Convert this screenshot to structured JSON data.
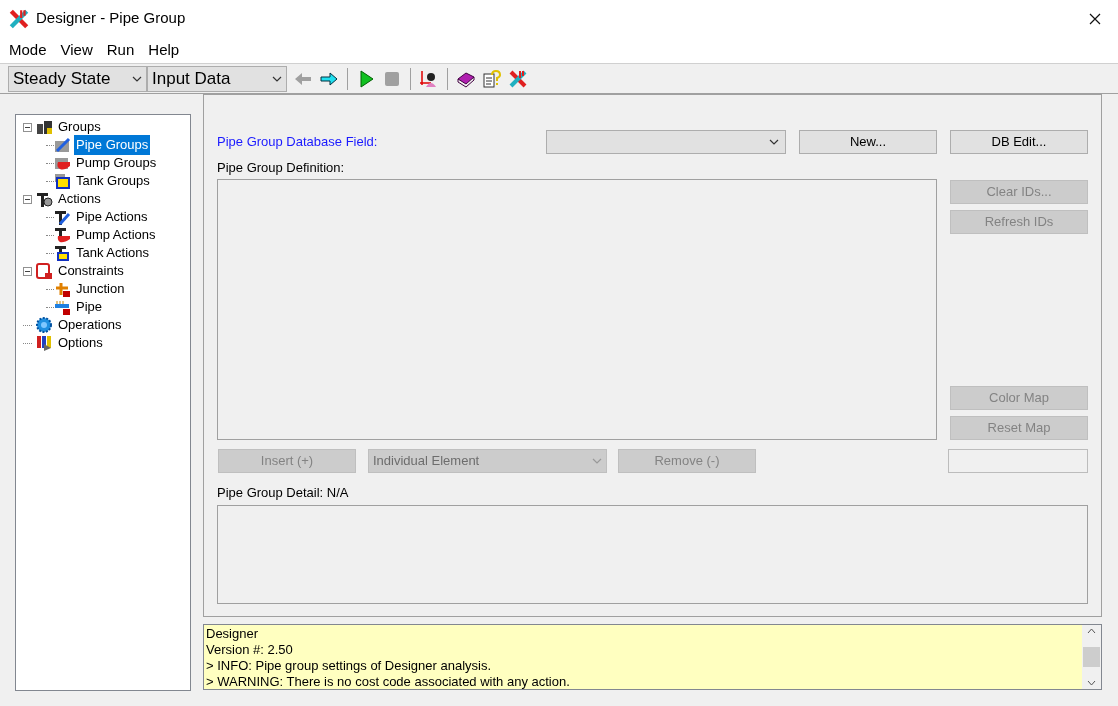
{
  "window": {
    "title": "Designer - Pipe Group"
  },
  "menu": [
    "Mode",
    "View",
    "Run",
    "Help"
  ],
  "toolbar": {
    "mode": "Steady State",
    "view": "Input Data",
    "tools": [
      {
        "kind": "back",
        "disabled": true
      },
      {
        "kind": "forward",
        "disabled": false
      },
      {
        "kind": "sep"
      },
      {
        "kind": "run",
        "disabled": false
      },
      {
        "kind": "stop",
        "disabled": true
      },
      {
        "kind": "sep"
      },
      {
        "kind": "person",
        "disabled": false
      },
      {
        "kind": "sep"
      },
      {
        "kind": "book",
        "disabled": false
      },
      {
        "kind": "help",
        "disabled": false
      },
      {
        "kind": "logo",
        "disabled": false
      }
    ]
  },
  "tree": [
    {
      "label": "Groups",
      "kind": "groups",
      "expanded": true,
      "selected": false,
      "children": [
        {
          "label": "Pipe Groups",
          "kind": "pipe-group",
          "selected": true
        },
        {
          "label": "Pump Groups",
          "kind": "pump-group",
          "selected": false
        },
        {
          "label": "Tank Groups",
          "kind": "tank-group",
          "selected": false
        }
      ]
    },
    {
      "label": "Actions",
      "kind": "actions",
      "expanded": true,
      "selected": false,
      "children": [
        {
          "label": "Pipe Actions",
          "kind": "pipe-action",
          "selected": false
        },
        {
          "label": "Pump Actions",
          "kind": "pump-action",
          "selected": false
        },
        {
          "label": "Tank Actions",
          "kind": "tank-action",
          "selected": false
        }
      ]
    },
    {
      "label": "Constraints",
      "kind": "constraints",
      "expanded": true,
      "selected": false,
      "children": [
        {
          "label": "Junction",
          "kind": "junction",
          "selected": false
        },
        {
          "label": "Pipe",
          "kind": "pipe",
          "selected": false
        }
      ]
    },
    {
      "label": "Operations",
      "kind": "operations",
      "selected": false
    },
    {
      "label": "Options",
      "kind": "options",
      "selected": false
    }
  ],
  "form": {
    "db_field_label": "Pipe Group Database Field:",
    "new_button": {
      "label": "New...",
      "disabled": false
    },
    "db_edit_button": {
      "label": "DB Edit...",
      "disabled": false
    },
    "definition_label": "Pipe Group Definition:",
    "side_buttons": [
      {
        "label": "Clear IDs...",
        "disabled": true
      },
      {
        "label": "Refresh IDs",
        "disabled": true
      }
    ],
    "map_buttons": [
      {
        "label": "Color Map",
        "disabled": true
      },
      {
        "label": "Reset Map",
        "disabled": true
      }
    ],
    "insert_button": {
      "label": "Insert (+)",
      "disabled": true
    },
    "element_select": {
      "value": "Individual Element",
      "disabled": true
    },
    "remove_button": {
      "label": "Remove (-)",
      "disabled": true
    },
    "detail_label": "Pipe Group Detail: N/A"
  },
  "log": [
    "Designer",
    "Version #: 2.50",
    "> INFO: Pipe group settings of Designer analysis.",
    "> WARNING: There is no cost code associated with any action."
  ]
}
